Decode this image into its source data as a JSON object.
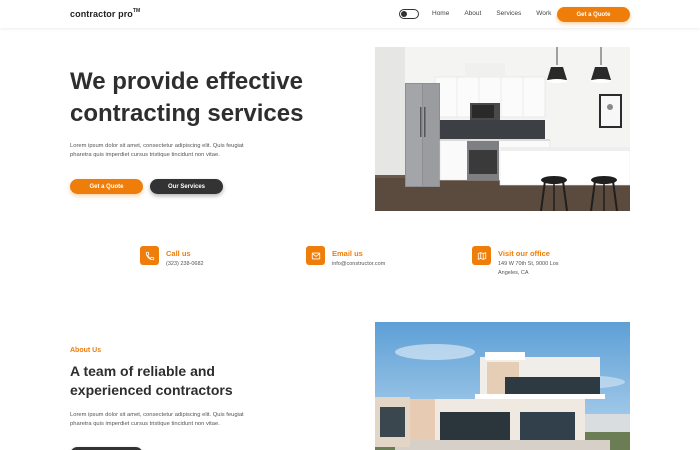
{
  "nav": {
    "logo": "contractor pro",
    "logo_mark": "TM",
    "links": [
      "Home",
      "About",
      "Services",
      "Work"
    ],
    "cta": "Get a Quote"
  },
  "hero": {
    "title_line1": "We provide effective",
    "title_line2": "contracting services",
    "description": "Lorem ipsum dolor sit amet, consectetur adipiscing elit. Quis feugiat pharetra quis imperdiet cursus tristique tincidunt non vitae.",
    "primary_button": "Get a Quote",
    "secondary_button": "Our Services"
  },
  "contact": [
    {
      "title": "Call us",
      "text": "(323) 238-0682",
      "icon": "phone-icon"
    },
    {
      "title": "Email us",
      "text": "info@constructor.com",
      "icon": "mail-icon"
    },
    {
      "title": "Visit our office",
      "text": "149 W 70th St, 9000 Los Angeles, CA",
      "icon": "map-icon"
    }
  ],
  "about": {
    "eyebrow": "About Us",
    "title": "A team of reliable and experienced contractors",
    "description": "Lorem ipsum dolor sit amet, consectetur adipiscing elit. Quis feugiat pharetra quis imperdiet cursus tristique tincidunt non vitae."
  },
  "colors": {
    "accent": "#ee7d0a",
    "dark_button": "#333333",
    "text": "#2e2e2e"
  }
}
